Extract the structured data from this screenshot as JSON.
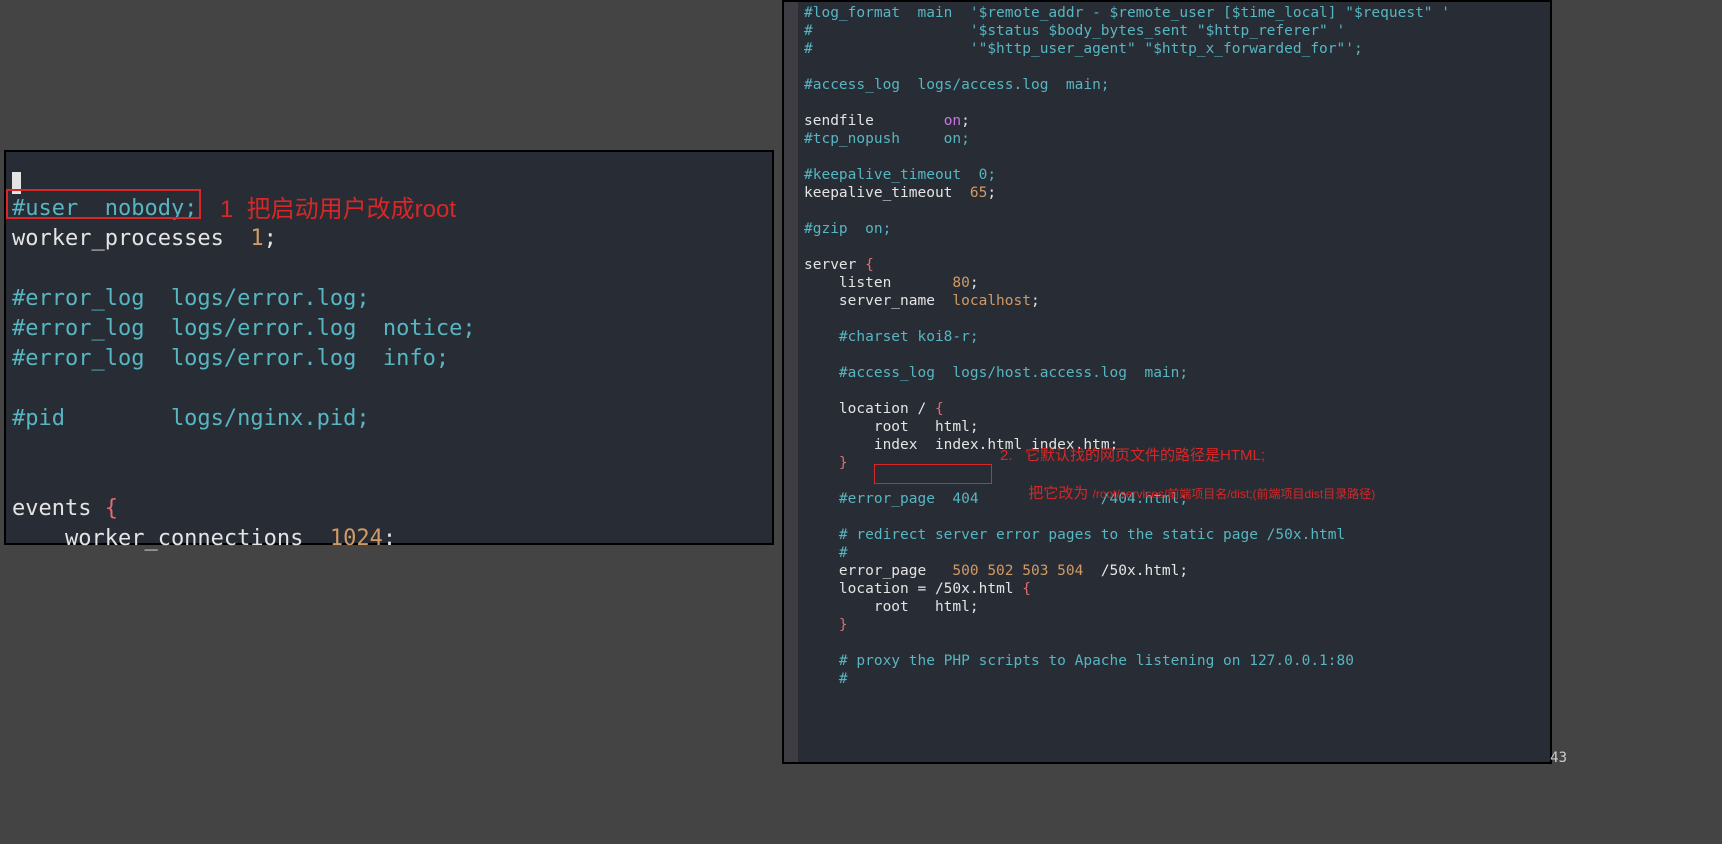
{
  "left": {
    "l1a": "#user  nobody;",
    "l2a": "worker_processes  ",
    "l2b": "1",
    "l2c": ";",
    "l4a": "#error_log  logs/error.log;",
    "l5a": "#error_log  logs/error.log  notice;",
    "l6a": "#error_log  logs/error.log  info;",
    "l8a": "#pid        logs/nginx.pid;",
    "l11a": "events",
    "l11b": " {",
    "l12a": "    worker_connections  ",
    "l12b": "1024",
    "l12c": ":"
  },
  "right": {
    "r1": "#log_format  main  '$remote_addr - $remote_user [$time_local] \"$request\" '",
    "r2": "#                  '$status $body_bytes_sent \"$http_referer\" '",
    "r3": "#                  '\"$http_user_agent\" \"$http_x_forwarded_for\"';",
    "r5": "#access_log  logs/access.log  main;",
    "r7a": "sendfile        ",
    "r7b": "on",
    "r7c": ";",
    "r8": "#tcp_nopush     on;",
    "r10": "#keepalive_timeout  0;",
    "r11a": "keepalive_timeout  ",
    "r11b": "65",
    "r11c": ";",
    "r13": "#gzip  on;",
    "r15a": "server",
    "r15b": " {",
    "r16a": "    listen       ",
    "r16b": "80",
    "r16c": ";",
    "r17a": "    server_name  ",
    "r17b": "localhost",
    "r17c": ";",
    "r19": "    #charset koi8-r;",
    "r21": "    #access_log  logs/host.access.log  main;",
    "r23a": "    location / ",
    "r23b": "{",
    "r24a": "        root   ",
    "r24b": "html;",
    "r25a": "        index  ",
    "r25b": "index.html index.htm;",
    "r26": "    }",
    "r28": "    #error_page  404              /404.html;",
    "r30": "    # redirect server error pages to the static page /50x.html",
    "r31": "    #",
    "r32a": "    error_page   ",
    "r32b": "500 502 503 504",
    "r32c": "  /50x.html;",
    "r33a": "    location",
    "r33b": " = /50x.html ",
    "r33c": "{",
    "r34a": "        root   ",
    "r34b": "html;",
    "r35": "    }",
    "r37": "    # proxy the PHP scripts to Apache listening on 127.0.0.1:80",
    "r38": "    #"
  },
  "annotations": {
    "a1": "1  把启动用户改成root",
    "a2": "2.   它默认找的网页文件的路径是HTML;",
    "a3a": "把它改为 ",
    "a3b": "/root/services/前端项目名/dist;(前端项目dist目录路径)"
  },
  "pagenum": "43"
}
